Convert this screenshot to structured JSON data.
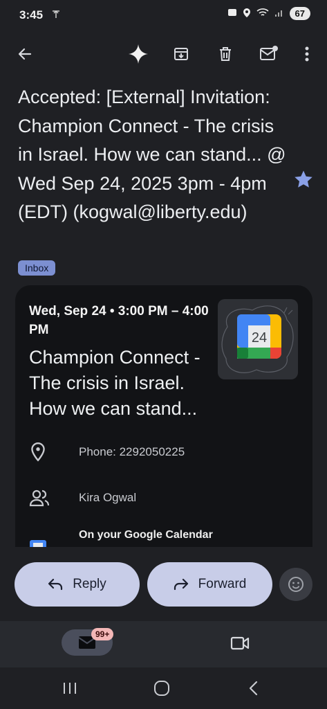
{
  "status_bar": {
    "time": "3:45",
    "battery": "67"
  },
  "email": {
    "subject": "Accepted: [External] Invitation: Champion Connect - The crisis in Israel. How we can stand... @ Wed Sep 24, 2025 3pm - 4pm (EDT) (kogwal@liberty.edu)",
    "label": "Inbox",
    "starred": true
  },
  "event_card": {
    "when": "Wed, Sep 24 • 3:00 PM – 4:00 PM",
    "title": "Champion Connect - The crisis in Israel. How we can stand...",
    "calendar_day": "24",
    "location": "Phone: 2292050225",
    "attendee": "Kira Ogwal",
    "calendar_note": "On your Google Calendar"
  },
  "actions": {
    "reply": "Reply",
    "forward": "Forward"
  },
  "bottom_nav": {
    "mail_badge": "99+"
  },
  "colors": {
    "background": "#1f2024",
    "card": "#121316",
    "pill": "#c8cde8",
    "star": "#8aa0e6",
    "chip": "#7c8fd1"
  }
}
